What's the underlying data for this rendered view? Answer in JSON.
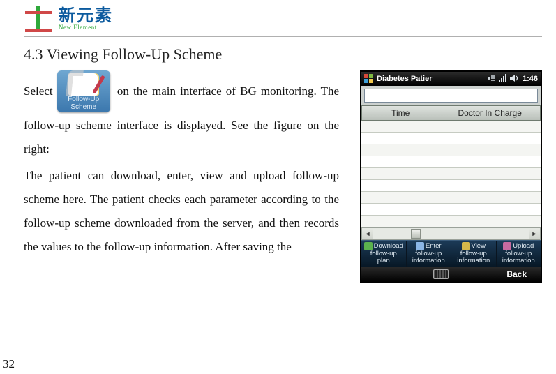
{
  "brand": {
    "cn": "新元素",
    "en": "New Element"
  },
  "section_title": "4.3 Viewing Follow-Up Scheme",
  "icon_caption_line1": "Follow-Up",
  "icon_caption_line2": "Scheme",
  "para1_lead": "Select",
  "para1_rest": "on the main interface of BG monitoring. The follow-up scheme interface is displayed. See the figure on the right:",
  "para2": "The patient can download, enter, view and upload follow-up scheme here. The patient checks each parameter according to the follow-up scheme downloaded from the server, and then records the values to the follow-up information. After saving the",
  "phone": {
    "title": "Diabetes Patier",
    "clock": "1:46",
    "columns": {
      "time": "Time",
      "doctor": "Doctor In Charge"
    },
    "buttons": {
      "b1_head": "Download",
      "b1_l2": "follow-up",
      "b1_l3": "plan",
      "b2_head": "Enter",
      "b2_l2": "follow-up",
      "b2_l3": "information",
      "b3_head": "View",
      "b3_l2": "follow-up",
      "b3_l3": "information",
      "b4_head": "Upload",
      "b4_l2": "follow-up",
      "b4_l3": "information"
    },
    "softkey_back": "Back"
  },
  "page_number": "32"
}
